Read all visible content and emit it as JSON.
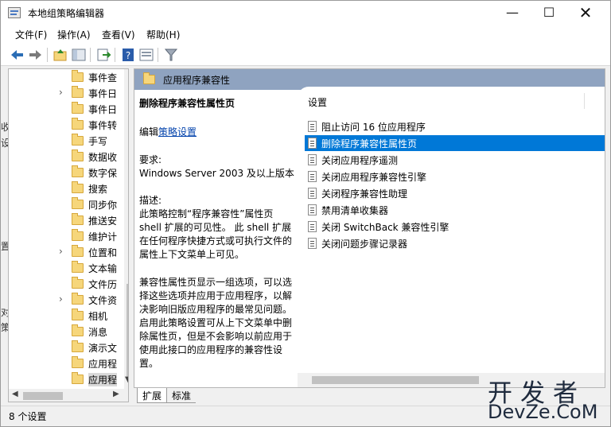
{
  "window": {
    "title": "本地组策略编辑器"
  },
  "window_controls": {
    "minimize": "—",
    "maximize": "☐",
    "close": "✕"
  },
  "menu": [
    "文件(F)",
    "操作(A)",
    "查看(V)",
    "帮助(H)"
  ],
  "toolbar": {
    "buttons": [
      "back-icon",
      "forward-icon",
      "up-folder-icon",
      "show-tree-icon",
      "export-list-icon",
      "help-icon",
      "properties-icon",
      "filter-icon"
    ]
  },
  "tree": {
    "items": [
      {
        "label": "事件查",
        "expandable": false
      },
      {
        "label": "事件日",
        "expandable": true
      },
      {
        "label": "事件日",
        "expandable": false
      },
      {
        "label": "事件转",
        "expandable": false
      },
      {
        "label": "手写",
        "expandable": false
      },
      {
        "label": "数据收",
        "expandable": false
      },
      {
        "label": "数字保",
        "expandable": false
      },
      {
        "label": "搜索",
        "expandable": false
      },
      {
        "label": "同步你",
        "expandable": false
      },
      {
        "label": "推送安",
        "expandable": false
      },
      {
        "label": "维护计",
        "expandable": false
      },
      {
        "label": "位置和",
        "expandable": true
      },
      {
        "label": "文本输",
        "expandable": false
      },
      {
        "label": "文件历",
        "expandable": false
      },
      {
        "label": "文件资",
        "expandable": true
      },
      {
        "label": "相机",
        "expandable": false
      },
      {
        "label": "消息",
        "expandable": false
      },
      {
        "label": "演示文",
        "expandable": false
      },
      {
        "label": "应用程",
        "expandable": false
      },
      {
        "label": "应用程",
        "expandable": false,
        "selected": true
      }
    ]
  },
  "right": {
    "header": "应用程序兼容性",
    "description": {
      "title": "删除程序兼容性属性页",
      "edit_prefix": "编辑",
      "edit_link": "策略设置",
      "requirements_label": "要求:",
      "requirements_value": "Windows Server 2003 及以上版本",
      "description_label": "描述:",
      "description_p1": "此策略控制“程序兼容性”属性页 shell 扩展的可见性。 此 shell 扩展在任何程序快捷方式或可执行文件的属性上下文菜单上可见。",
      "description_p2": "兼容性属性页显示一组选项，可以选择这些选项并应用于应用程序，以解决影响旧版应用程序的最常见问题。 启用此策略设置可从上下文菜单中删除属性页，但是不会影响以前应用于使用此接口的应用程序的兼容性设置。"
    },
    "list_header": "设置",
    "settings": [
      {
        "label": "阻止访问 16 位应用程序"
      },
      {
        "label": "删除程序兼容性属性页",
        "selected": true
      },
      {
        "label": "关闭应用程序遥测"
      },
      {
        "label": "关闭应用程序兼容性引擎"
      },
      {
        "label": "关闭程序兼容性助理"
      },
      {
        "label": "禁用清单收集器"
      },
      {
        "label": "关闭 SwitchBack 兼容性引擎"
      },
      {
        "label": "关闭问题步骤记录器"
      }
    ]
  },
  "tabs": [
    "扩展",
    "标准"
  ],
  "status": "8 个设置",
  "watermark": {
    "line1": "开发者",
    "line2": "DevZe.CoM"
  },
  "colors": {
    "selection": "#0078d7",
    "header_band": "#8fa3c0",
    "folder": "#f6d67b",
    "link": "#0645ad"
  }
}
